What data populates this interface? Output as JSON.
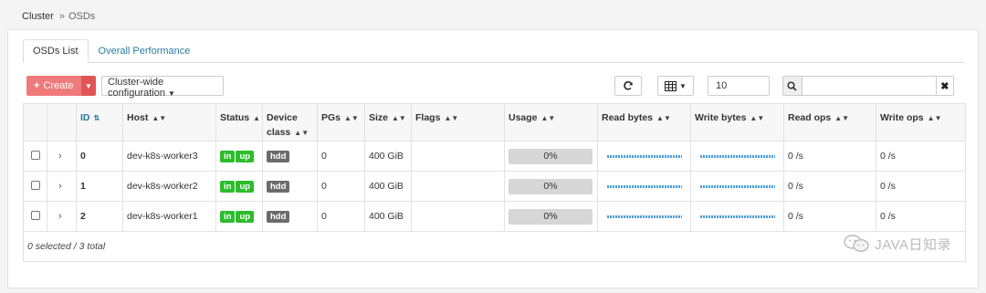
{
  "breadcrumb": {
    "root": "Cluster",
    "separator": "»",
    "current": "OSDs"
  },
  "tabs": [
    {
      "label": "OSDs List",
      "active": true
    },
    {
      "label": "Overall Performance",
      "active": false
    }
  ],
  "toolbar": {
    "create_label": "Create",
    "config_label": "Cluster-wide configuration",
    "page_size": "10",
    "search_placeholder": ""
  },
  "table": {
    "columns": {
      "id": "ID",
      "host": "Host",
      "status": "Status",
      "device_class": "Device class",
      "pgs": "PGs",
      "size": "Size",
      "flags": "Flags",
      "usage": "Usage",
      "read_bytes": "Read bytes",
      "write_bytes": "Write bytes",
      "read_ops": "Read ops",
      "write_ops": "Write ops"
    },
    "rows": [
      {
        "id": "0",
        "host": "dev-k8s-worker3",
        "status_in": "in",
        "status_up": "up",
        "device_class": "hdd",
        "pgs": "0",
        "size": "400 GiB",
        "flags": "",
        "usage": "0%",
        "usage_fraction": 0,
        "read_ops": "0 /s",
        "write_ops": "0 /s"
      },
      {
        "id": "1",
        "host": "dev-k8s-worker2",
        "status_in": "in",
        "status_up": "up",
        "device_class": "hdd",
        "pgs": "0",
        "size": "400 GiB",
        "flags": "",
        "usage": "0%",
        "usage_fraction": 0,
        "read_ops": "0 /s",
        "write_ops": "0 /s"
      },
      {
        "id": "2",
        "host": "dev-k8s-worker1",
        "status_in": "in",
        "status_up": "up",
        "device_class": "hdd",
        "pgs": "0",
        "size": "400 GiB",
        "flags": "",
        "usage": "0%",
        "usage_fraction": 0,
        "read_ops": "0 /s",
        "write_ops": "0 /s"
      }
    ],
    "footer": "0 selected / 3 total"
  },
  "icons": {
    "refresh": "refresh-icon",
    "columns": "table-columns-icon",
    "search": "search-icon",
    "clear": "close-icon"
  },
  "colors": {
    "create_button": "#f07a7a",
    "status_green": "#2cbc2c",
    "device_class_grey": "#6b6b6b",
    "link_blue": "#2a7ca0",
    "sparkline": "#4a9de0"
  },
  "watermark": "JAVA日知录"
}
